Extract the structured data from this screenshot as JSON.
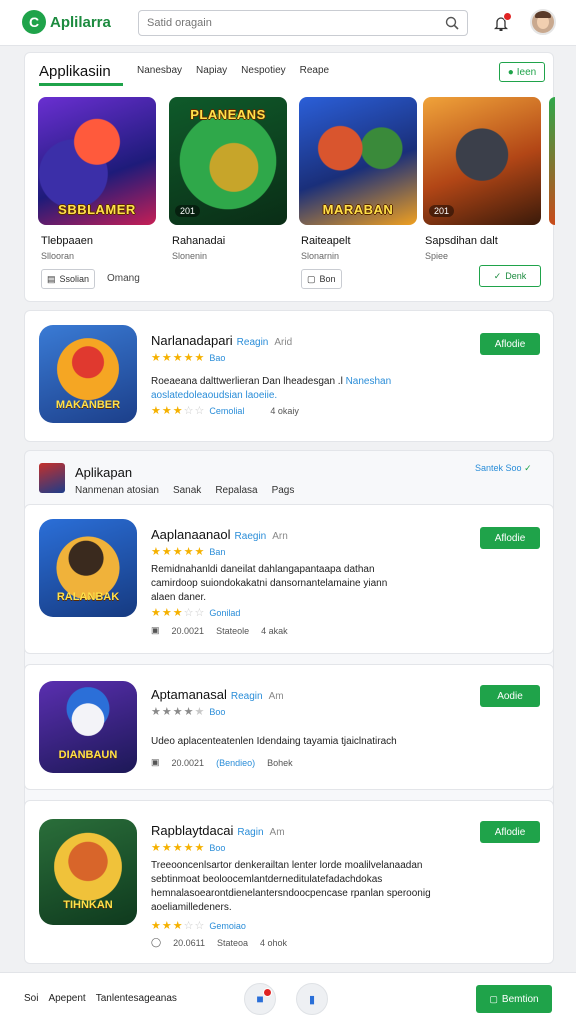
{
  "header": {
    "logo_letter": "C",
    "logo_text": "Aplilarra",
    "search_placeholder": "Satid oragain"
  },
  "apps_section": {
    "title": "Applikasiin",
    "tabs": [
      "Nanesbay",
      "Napiay",
      "Nespotiey",
      "Reape"
    ],
    "view_button": "Ieen",
    "items": [
      {
        "art_title": "SBBLAMER",
        "name": "Tlebpaaen",
        "sub": "Sllooran",
        "chip": ""
      },
      {
        "art_title": "PLANEANS",
        "name": "Rahanadai",
        "sub": "Slonenin",
        "chip": "201"
      },
      {
        "art_title": "MARABAN",
        "name": "Raiteapelt",
        "sub": "Slonarnin",
        "chip": ""
      },
      {
        "art_title": "",
        "name": "Sapsdihan dalt",
        "sub": "Spiee",
        "chip": "201"
      }
    ],
    "actions": {
      "left_button": "Ssolian",
      "left_text": "Omang",
      "mid_button": "Bon",
      "right_button": "Denk"
    }
  },
  "app_rows": [
    {
      "name": "Narlanadapari",
      "tag": "Reagin",
      "dim": "Arid",
      "rating": 5,
      "rating_note": "Bao",
      "desc_lines": [
        "Roeaeana dalttwerlieran Dan lheadesgan .l",
        "Naneshan",
        "aoslatedoleaoudsian laoeiie."
      ],
      "second_rating": 3.5,
      "second_note": "Cemolial",
      "meta": [
        "4 okaiy"
      ],
      "install": "Aflodie"
    }
  ],
  "group2": {
    "title": "Aplikapan",
    "tabs": [
      "Nanmenan atosian",
      "Sanak",
      "Repalasa",
      "Pags"
    ],
    "link": "Santek Soo",
    "rows": [
      {
        "name": "Aaplanaanaol",
        "tag": "Raegin",
        "dim": "Arn",
        "rating": 5,
        "rating_note": "Ban",
        "desc_lines": [
          "Remidnahanldi daneilat dahlangapantaapa dathan",
          "camirdoop suiondokakatni dansornantelamaine yiann",
          "alaen daner."
        ],
        "second_rating": 3.5,
        "second_note": "Gonilad",
        "meta": [
          "20.0021",
          "Stateole",
          "4 akak"
        ],
        "install": "Aflodie"
      },
      {
        "name": "Aptamanasal",
        "tag": "Reagin",
        "dim": "Am",
        "rating": 4,
        "rating_note": "Boo",
        "desc_lines": [
          "Udeo aplacenteatenlen Idendaing tayamia tjaiclnatirach"
        ],
        "second_rating": 0,
        "second_note": "",
        "meta": [
          "20.0021",
          "Bendieo",
          "Bohek"
        ],
        "install": "Aodie"
      },
      {
        "name": "Rapblaytdacai",
        "tag": "Ragin",
        "dim": "Am",
        "rating": 5,
        "rating_note": "Boo",
        "desc_lines": [
          "Treeooncenlsartor denkerailtan lenter lorde moalilvelanaadan",
          "sebtinmoat beoloocemlantderneditulatefadachdokas",
          "hemnalasoearontdienelantersndoocpencase rpanlan speroonig",
          "aoeliamilledeners."
        ],
        "second_rating": 3.5,
        "second_note": "Gemoiao",
        "meta": [
          "20.0611",
          "Stateoa",
          "4 ohok"
        ],
        "install": "Aflodie"
      }
    ]
  },
  "bottom": {
    "texts": [
      "Soi",
      "Apepent",
      "Tanlentesageanas"
    ],
    "cta": "Bemtion"
  },
  "colors": {
    "brand_green": "#1fa34a",
    "link_blue": "#2a8dd8",
    "star": "#f5b100",
    "alert_red": "#e02424"
  }
}
